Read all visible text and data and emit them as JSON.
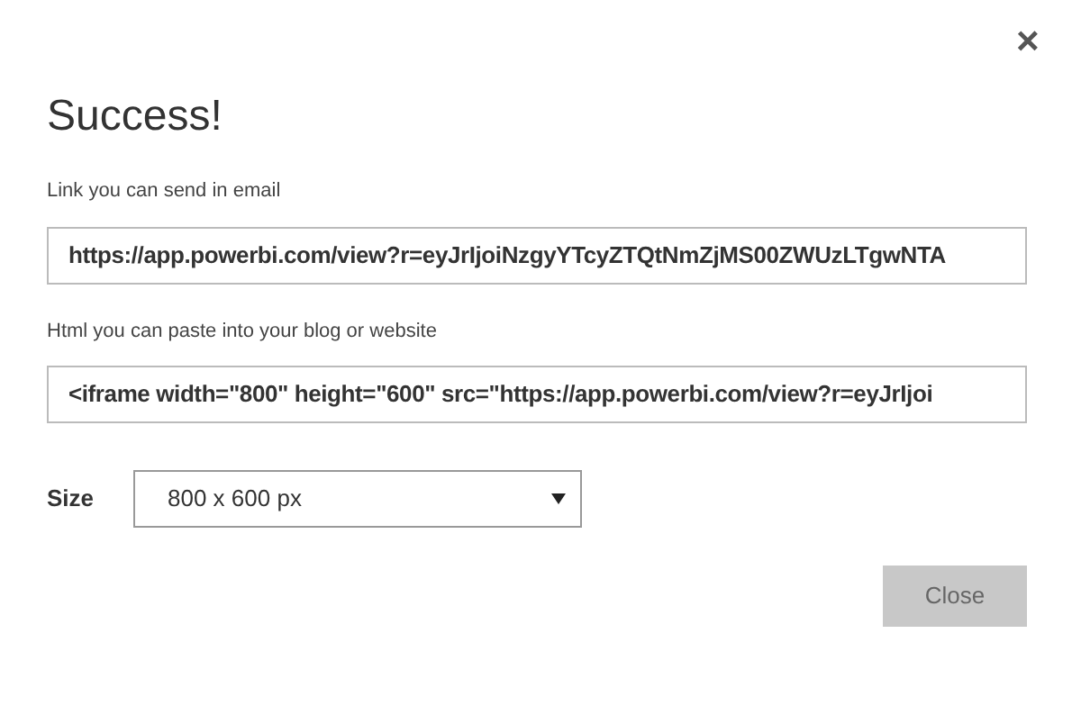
{
  "dialog": {
    "close_glyph": "×",
    "title": "Success!"
  },
  "fields": [
    {
      "label": "Link you can send in email",
      "value": "https://app.powerbi.com/view?r=eyJrIjoiNzgyYTcyZTQtNmZjMS00ZWUzLTgwNTA"
    },
    {
      "label": "Html you can paste into your blog or website",
      "value": "<iframe width=\"800\" height=\"600\" src=\"https://app.powerbi.com/view?r=eyJrIjoi"
    }
  ],
  "size": {
    "label": "Size",
    "value": "800 x 600 px"
  },
  "buttons": [
    "Close"
  ]
}
